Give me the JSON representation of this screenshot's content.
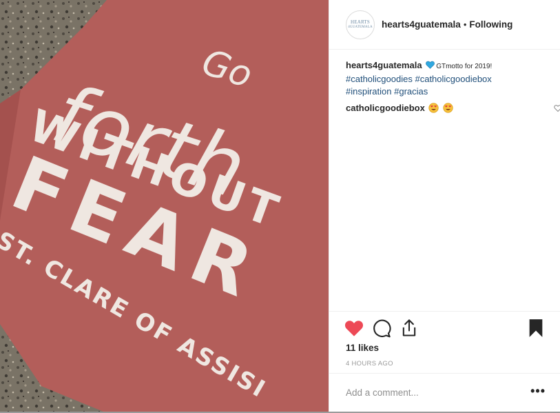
{
  "header": {
    "username": "hearts4guatemala",
    "separator": "•",
    "follow_state": "Following",
    "avatar_text_line1": "HEARTS",
    "avatar_text_line2": "4GUATEMALA"
  },
  "photo": {
    "shirt_line1": "Go",
    "shirt_line2": "forth",
    "shirt_line3": "WITHOUT",
    "shirt_line4": "FEAR",
    "shirt_line5": "ST. CLARE OF ASSISI",
    "shirt_color": "#b35e5a"
  },
  "caption": {
    "username": "hearts4guatemala",
    "emoji_icon": "blue-heart-icon",
    "text": "GTmotto for 2019!",
    "hashtags": [
      "#catholicgoodies",
      "#catholicgoodiebox",
      "#inspiration",
      "#gracias"
    ]
  },
  "comments": [
    {
      "username": "catholicgoodiebox",
      "emojis": "heart-eyes-icon heart-eyes-icon"
    }
  ],
  "actions": {
    "like_color": "#ed4956",
    "like_icon": "heart-filled-icon",
    "comment_icon": "comment-bubble-icon",
    "share_icon": "share-icon",
    "save_icon": "bookmark-filled-icon"
  },
  "likes": "11 likes",
  "timestamp": "4 HOURS AGO",
  "add_comment": {
    "placeholder": "Add a comment...",
    "more_label": "•••"
  }
}
